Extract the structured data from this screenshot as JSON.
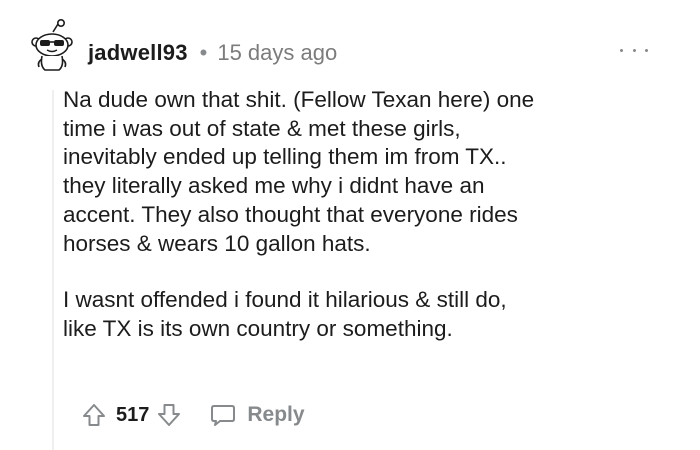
{
  "comment": {
    "username": "jadwell93",
    "separator": "•",
    "timestamp": "15 days ago",
    "avatar_icon": "snoo-avatar-sunglasses-icon",
    "more_icon": "more-options-icon",
    "body_paragraphs": [
      [
        "Na dude own that shit. (Fellow Texan here) one",
        "time i was out of state & met these girls,",
        "inevitably ended up telling them im from TX..",
        "they literally asked me why i didnt have an",
        "accent. They also thought that everyone rides",
        "horses & wears 10 gallon hats."
      ],
      [
        "I wasnt offended i found it hilarious & still do,",
        "like TX is its own country or something."
      ]
    ],
    "actions": {
      "score": "517",
      "reply_label": "Reply",
      "upvote_icon": "upvote-arrow-icon",
      "downvote_icon": "downvote-arrow-icon",
      "reply_icon": "speech-bubble-icon"
    }
  }
}
